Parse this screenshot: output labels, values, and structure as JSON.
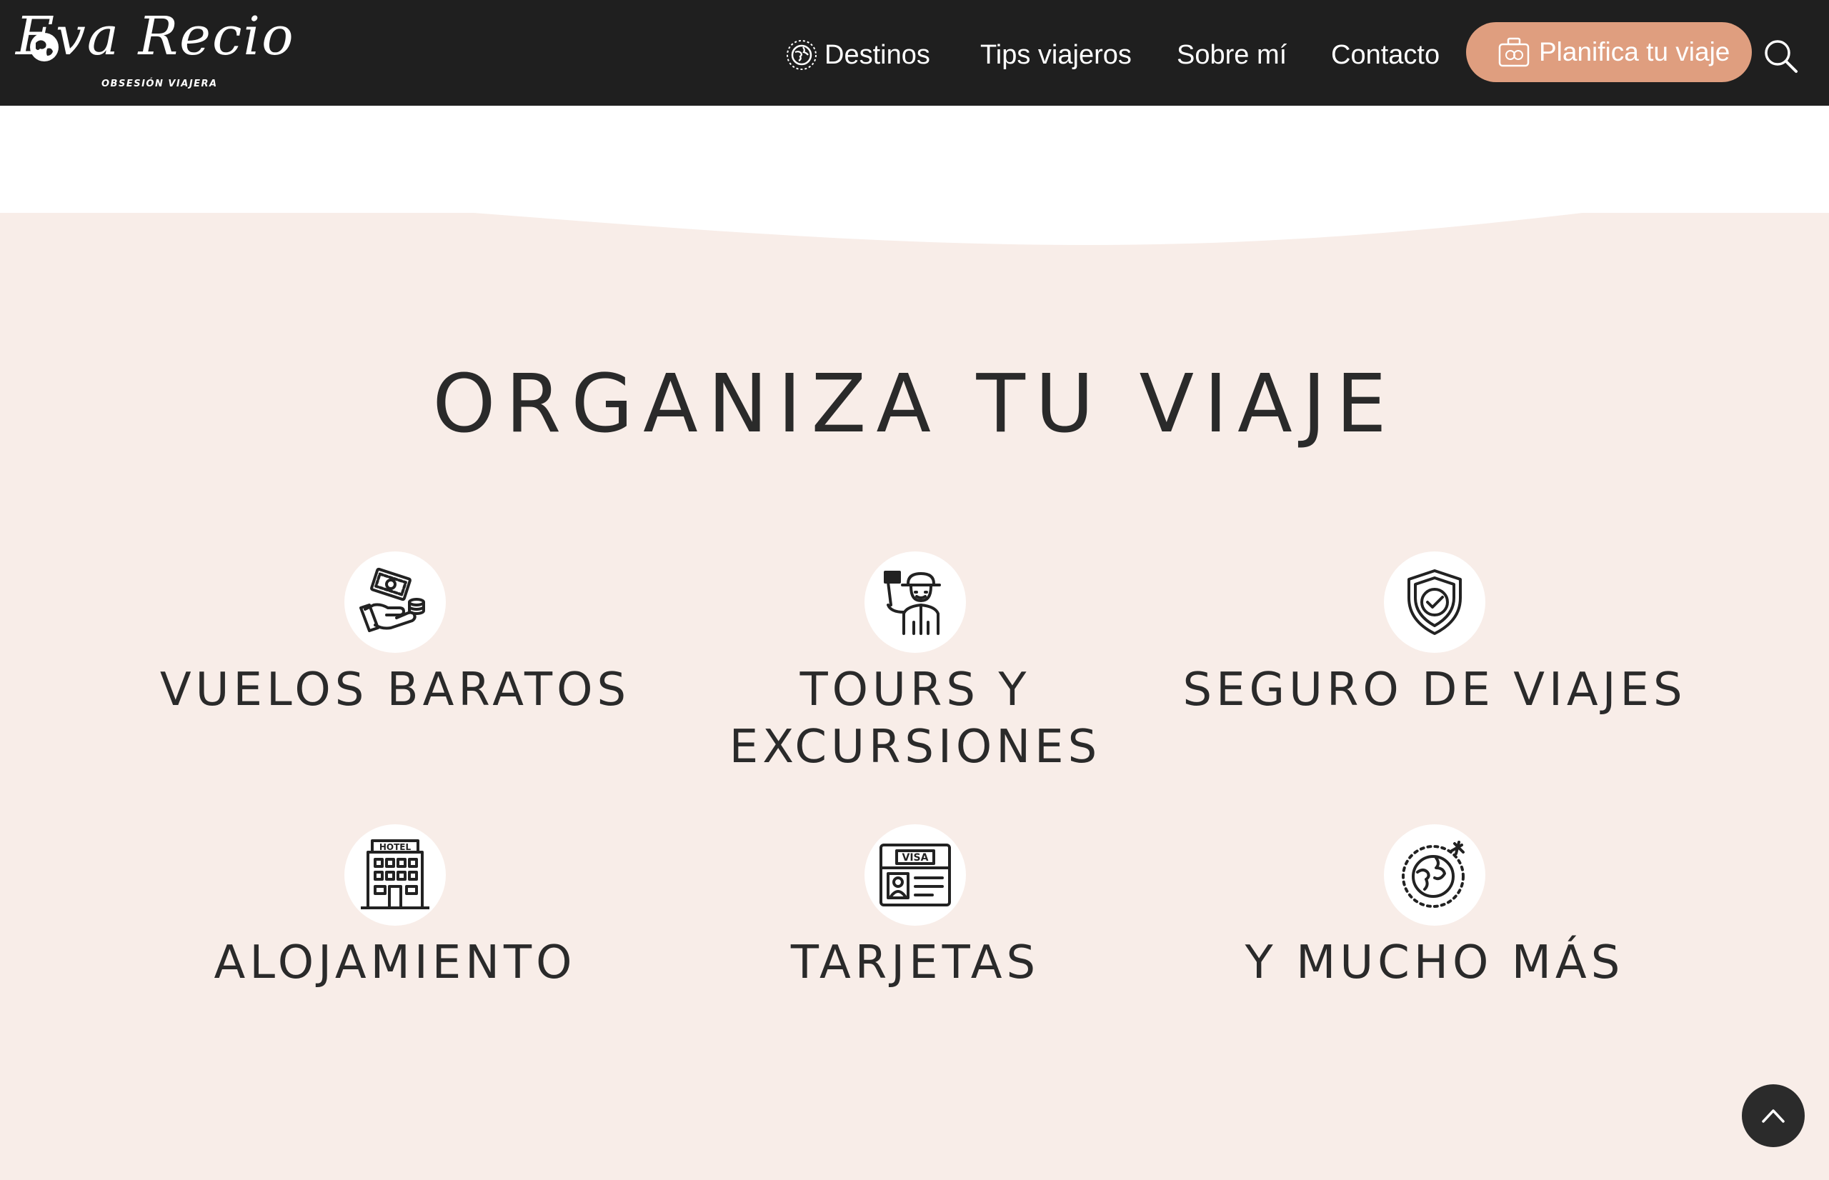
{
  "brand": {
    "name": "Eva Recio",
    "tagline": "OBSESIÓN VIAJERA",
    "logo_icon": "globe-icon"
  },
  "nav": {
    "items": [
      {
        "label": "Destinos",
        "icon": "globe-icon"
      },
      {
        "label": "Tips viajeros"
      },
      {
        "label": "Sobre mí"
      },
      {
        "label": "Contacto"
      }
    ],
    "cta": {
      "label": "Planifica tu viaje",
      "icon": "suitcase-icon"
    },
    "search_icon": "search-icon"
  },
  "section": {
    "title": "ORGANIZA TU VIAJE",
    "items": [
      {
        "label": "VUELOS BARATOS",
        "icon": "money-hand-icon"
      },
      {
        "label": "TOURS Y EXCURSIONES",
        "icon": "tour-guide-icon"
      },
      {
        "label": "SEGURO DE VIAJES",
        "icon": "shield-check-icon"
      },
      {
        "label": "ALOJAMIENTO",
        "icon": "hotel-icon",
        "sign": "HOTEL"
      },
      {
        "label": "TARJETAS",
        "icon": "visa-card-icon",
        "sign": "VISA"
      },
      {
        "label": "Y MUCHO MÁS",
        "icon": "globe-plane-icon"
      }
    ]
  },
  "scroll_top": {
    "icon": "chevron-up-icon"
  },
  "colors": {
    "header_bg": "#1f1f1f",
    "section_bg": "#f8ede8",
    "cta_bg": "#df9e7f",
    "text_dark": "#2a2a2a"
  }
}
